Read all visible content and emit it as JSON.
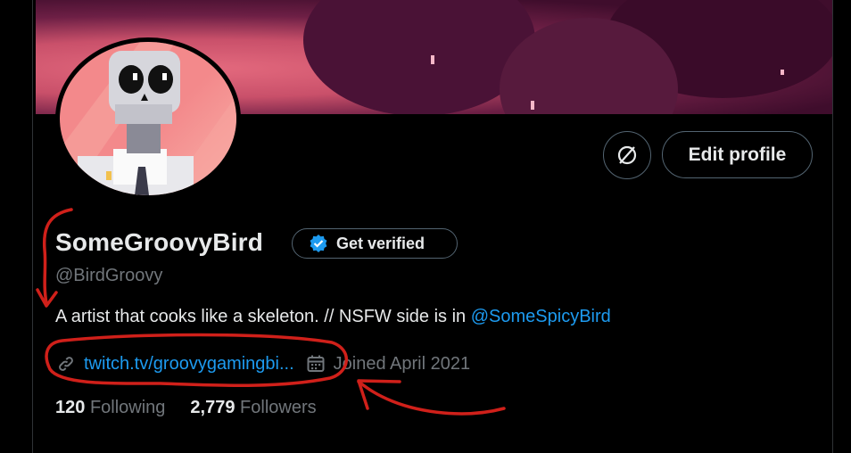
{
  "profile": {
    "display_name": "SomeGroovyBird",
    "handle": "@BirdGroovy",
    "bio_text": "A artist that cooks like a skeleton. // NSFW side is in ",
    "bio_mention": "@SomeSpicyBird",
    "website": "twitch.tv/groovygamingbi...",
    "joined": "Joined April 2021",
    "following_count": "120",
    "following_label": "Following",
    "followers_count": "2,779",
    "followers_label": "Followers"
  },
  "buttons": {
    "get_verified": "Get verified",
    "edit_profile": "Edit profile"
  },
  "icons": {
    "options": "no-entry-circle-icon",
    "verified": "verified-badge-icon",
    "link": "link-icon",
    "calendar": "calendar-icon"
  },
  "colors": {
    "background": "#000000",
    "link_blue": "#1d9bf0",
    "muted_text": "#71767b",
    "annotation_red": "#d0201a"
  }
}
